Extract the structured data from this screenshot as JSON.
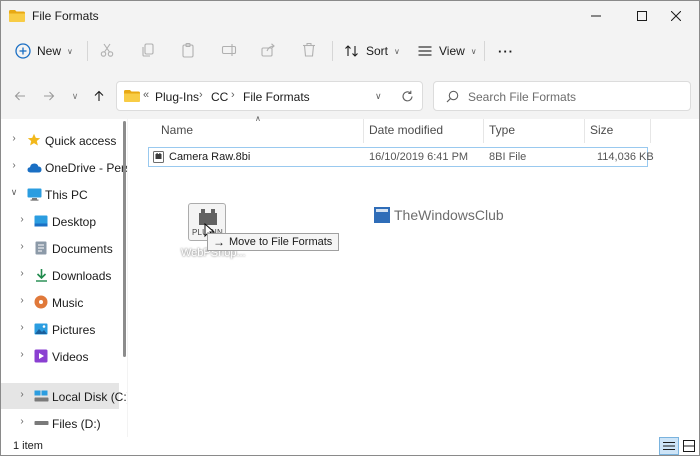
{
  "window": {
    "title": "File Formats"
  },
  "title_controls": {
    "minimize": "minimize-icon",
    "maximize": "maximize-icon",
    "close": "close-icon"
  },
  "toolbar": {
    "new_label": "New",
    "sort_label": "Sort",
    "view_label": "View",
    "more_label": "···"
  },
  "address": {
    "overflow": "«",
    "segments": [
      "Plug-Ins",
      "CC",
      "File Formats"
    ]
  },
  "search": {
    "placeholder": "Search File Formats"
  },
  "nav": {
    "items": [
      {
        "label": "Quick access",
        "icon": "star-icon"
      },
      {
        "label": "OneDrive - Perso",
        "icon": "cloud-icon"
      },
      {
        "label": "This PC",
        "icon": "computer-icon"
      },
      {
        "label": "Desktop",
        "icon": "desktop-icon"
      },
      {
        "label": "Documents",
        "icon": "documents-icon"
      },
      {
        "label": "Downloads",
        "icon": "download-icon"
      },
      {
        "label": "Music",
        "icon": "music-icon"
      },
      {
        "label": "Pictures",
        "icon": "pictures-icon"
      },
      {
        "label": "Videos",
        "icon": "videos-icon"
      },
      {
        "label": "Local Disk (C:)",
        "icon": "drive-icon"
      },
      {
        "label": "Files (D:)",
        "icon": "drive-icon"
      }
    ]
  },
  "columns": {
    "name": "Name",
    "date": "Date modified",
    "type": "Type",
    "size": "Size"
  },
  "files": [
    {
      "name": "Camera Raw.8bi",
      "date": "16/10/2019 6:41 PM",
      "type": "8BI File",
      "size": "114,036 KB"
    }
  ],
  "drag": {
    "icon_text": "PLUGIN",
    "label": "WebPShop...",
    "tooltip": "Move to File Formats"
  },
  "watermark": "TheWindowsClub",
  "status": {
    "item_count": "1 item"
  },
  "colors": {
    "accent": "#0067c0",
    "folder": "#f3c12d",
    "selection_border": "#99c9ef"
  }
}
